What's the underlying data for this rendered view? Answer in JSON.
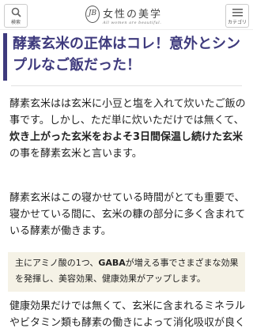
{
  "header": {
    "search_label": "検索",
    "logo_mark": "JB",
    "logo_name": "女性の美学",
    "logo_tagline": "All women are beautiful.",
    "menu_label": "カテゴリ"
  },
  "article": {
    "title_line1": "酵素玄米の正体はコレ！意外とシン",
    "title_line2": "プルなご飯だった！",
    "p1_a": "酵素玄米はは玄米に小豆と塩を入れて炊いたご飯の事です。しかし、ただ単に炊いただけでは無くて、",
    "p1_bold": "炊き上がった玄米をおよそ3日間保温し続けた玄米",
    "p1_b": "の事を酵素玄米と言います。",
    "p2": "酵素玄米はこの寝かせている時間がとても重要で、寝かせている間に、玄米の糠の部分に多く含まれている酵素が働きます。",
    "box_a": "主にアミノ酸の1つ、",
    "box_bold": "GABA",
    "box_b": "が増える事でさまざまな効果を発揮し、美容効果、健康効果がアップします。",
    "p4": "健康効果だけでは無くて、玄米に含まれるミネラルやビタミン類も酵素の働きによって消化吸収が良く"
  }
}
